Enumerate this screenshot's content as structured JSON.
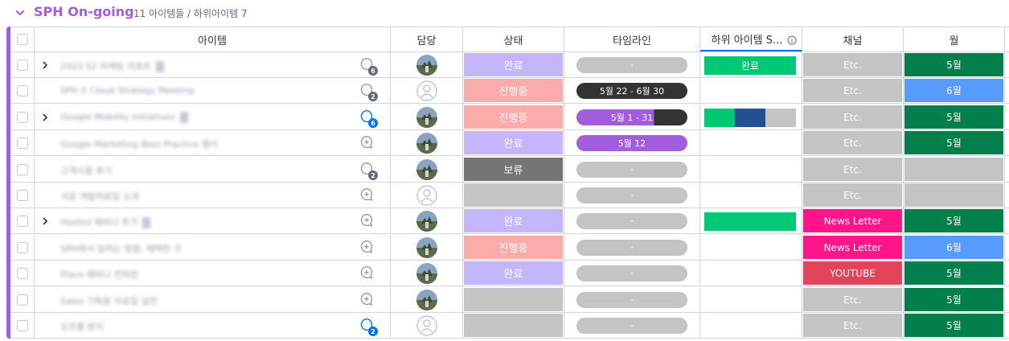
{
  "group": {
    "title": "SPH On-going",
    "count_label": "11 아이템들 / 하위아이템 7",
    "accent_color": "#a25ddc"
  },
  "columns": {
    "item": "아이템",
    "owner": "담당",
    "status": "상태",
    "timeline": "타임라인",
    "subitem_status": "하위 아이템 S...",
    "channel": "채널",
    "month": "월"
  },
  "colors": {
    "done": "#c4b5fd",
    "working": "#fcabab",
    "stuck": "#757575",
    "empty": "#c4c4c4",
    "green": "#00c875",
    "dark_green": "#037f4c",
    "blue": "#579bfc",
    "navy": "#225091",
    "pink": "#ff158a",
    "red": "#e2445c",
    "timeline_dark": "#333333",
    "timeline_purple": "#a25ddc",
    "timeline_empty": "#c4c4c4"
  },
  "rows": [
    {
      "expandable": true,
      "name": "2023 S2 마케팅 리포트",
      "has_subbadge": true,
      "updates": "6",
      "updates_blue": false,
      "owner": "photo",
      "status": "완료",
      "status_color": "done",
      "timeline": "-",
      "timeline_style": "empty",
      "sub_status": "완료",
      "sub_status_style": "green",
      "channel": "Etc.",
      "channel_color": "empty",
      "month": "5월",
      "month_color": "dark_green"
    },
    {
      "expandable": false,
      "name": "SPH X Cloud Strategy Meeting",
      "has_subbadge": false,
      "updates": "2",
      "updates_blue": false,
      "owner": "empty",
      "status": "진행중",
      "status_color": "working",
      "timeline": "5월 22 - 6월 30",
      "timeline_style": "dark",
      "sub_status": "",
      "sub_status_style": "none",
      "channel": "Etc.",
      "channel_color": "empty",
      "month": "6월",
      "month_color": "blue"
    },
    {
      "expandable": true,
      "name": "Google Mobility Initiatives",
      "has_subbadge": true,
      "updates": "6",
      "updates_blue": true,
      "owner": "photo",
      "status": "진행중",
      "status_color": "working",
      "timeline": "5월 1 - 31",
      "timeline_style": "split",
      "sub_status": "",
      "sub_status_style": "multi",
      "channel": "Etc.",
      "channel_color": "empty",
      "month": "5월",
      "month_color": "dark_green"
    },
    {
      "expandable": false,
      "name": "Google Marketing Best Practice 행사",
      "has_subbadge": false,
      "updates": "",
      "updates_blue": false,
      "owner": "photo",
      "status": "완료",
      "status_color": "done",
      "timeline": "5월 12",
      "timeline_style": "purple",
      "sub_status": "",
      "sub_status_style": "none",
      "channel": "Etc.",
      "channel_color": "empty",
      "month": "5월",
      "month_color": "dark_green"
    },
    {
      "expandable": false,
      "name": "고객사용 후기",
      "has_subbadge": false,
      "updates": "2",
      "updates_blue": false,
      "owner": "photo",
      "status": "보류",
      "status_color": "stuck",
      "timeline": "-",
      "timeline_style": "empty",
      "sub_status": "",
      "sub_status_style": "none",
      "channel": "Etc.",
      "channel_color": "empty",
      "month": "",
      "month_color": "empty"
    },
    {
      "expandable": false,
      "name": "서로 개발자료집 소개",
      "has_subbadge": false,
      "updates": "",
      "updates_blue": false,
      "owner": "empty",
      "status": "",
      "status_color": "empty",
      "timeline": "-",
      "timeline_style": "empty",
      "sub_status": "",
      "sub_status_style": "none",
      "channel": "Etc.",
      "channel_color": "empty",
      "month": "",
      "month_color": "empty"
    },
    {
      "expandable": true,
      "name": "Hosted 웨비나 후기",
      "has_subbadge": true,
      "updates": "",
      "updates_blue": false,
      "owner": "photo",
      "status": "완료",
      "status_color": "done",
      "timeline": "-",
      "timeline_style": "empty",
      "sub_status": "",
      "sub_status_style": "green_only",
      "channel": "News Letter",
      "channel_color": "pink",
      "month": "5월",
      "month_color": "dark_green"
    },
    {
      "expandable": false,
      "name": "SPH에서 일하는 방법, 채택한 것",
      "has_subbadge": false,
      "updates": "",
      "updates_blue": false,
      "owner": "photo",
      "status": "진행중",
      "status_color": "working",
      "timeline": "-",
      "timeline_style": "empty",
      "sub_status": "",
      "sub_status_style": "none",
      "channel": "News Letter",
      "channel_color": "pink",
      "month": "6월",
      "month_color": "blue"
    },
    {
      "expandable": false,
      "name": "Place 웨비나 컨퍼런",
      "has_subbadge": false,
      "updates": "",
      "updates_blue": false,
      "owner": "photo",
      "status": "완료",
      "status_color": "done",
      "timeline": "-",
      "timeline_style": "empty",
      "sub_status": "",
      "sub_status_style": "none",
      "channel": "YOUTUBE",
      "channel_color": "red",
      "month": "5월",
      "month_color": "dark_green"
    },
    {
      "expandable": false,
      "name": "Sales 기획용 자료집 실전",
      "has_subbadge": false,
      "updates": "",
      "updates_blue": false,
      "owner": "photo",
      "status": "",
      "status_color": "empty",
      "timeline": "-",
      "timeline_style": "empty",
      "sub_status": "",
      "sub_status_style": "none",
      "channel": "Etc.",
      "channel_color": "empty",
      "month": "5월",
      "month_color": "dark_green"
    },
    {
      "expandable": false,
      "name": "오프폴 방지",
      "has_subbadge": false,
      "updates": "2",
      "updates_blue": true,
      "owner": "empty",
      "status": "",
      "status_color": "empty",
      "timeline": "-",
      "timeline_style": "empty",
      "sub_status": "",
      "sub_status_style": "none",
      "channel": "Etc.",
      "channel_color": "empty",
      "month": "5월",
      "month_color": "dark_green"
    }
  ]
}
